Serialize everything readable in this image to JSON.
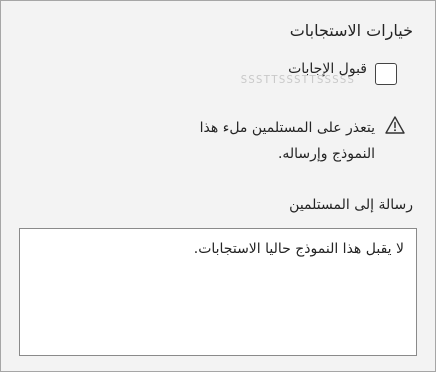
{
  "panel": {
    "section_title": "خيارات الاستجابات",
    "accept_responses": {
      "label": "قبول الإجابات",
      "checked": false,
      "ghost_text": "SSSTTSSSTTSSSSS"
    },
    "warning": {
      "icon": "warning-triangle-icon",
      "text": "يتعذر على المستلمين ملء هذا النموذج وإرساله."
    },
    "message": {
      "label": "رسالة إلى المستلمين",
      "value": "لا يقبل هذا النموذج حاليا الاستجابات."
    }
  }
}
